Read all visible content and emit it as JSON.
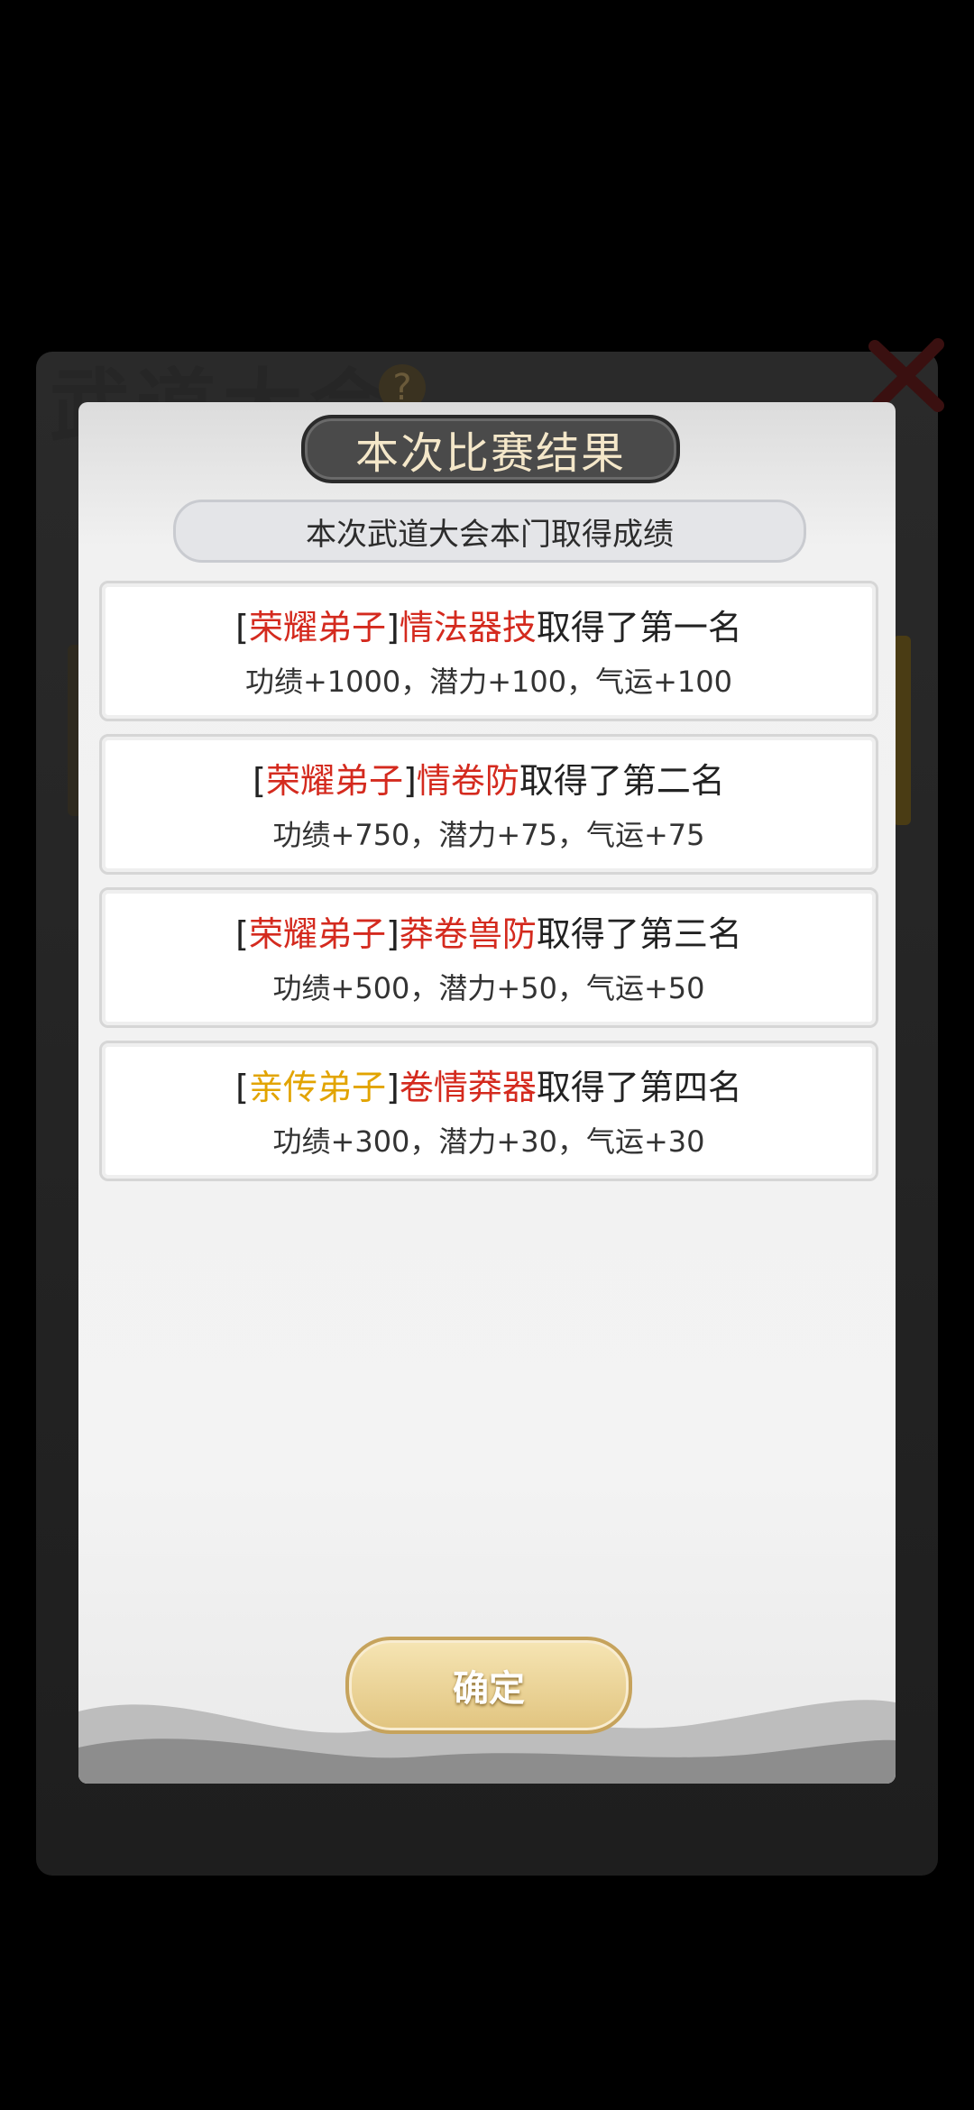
{
  "background": {
    "title": "武道大会",
    "help_glyph": "?"
  },
  "modal": {
    "header": "本次比赛结果",
    "subheader": "本次武道大会本门取得成绩",
    "results": [
      {
        "rank_tag": "荣耀弟子",
        "rank_color": "#d42a1e",
        "name": "情法器技",
        "place_text": "取得了第一名",
        "rewards": "功绩+1000，潜力+100，气运+100"
      },
      {
        "rank_tag": "荣耀弟子",
        "rank_color": "#d42a1e",
        "name": "情卷防",
        "place_text": "取得了第二名",
        "rewards": "功绩+750，潜力+75，气运+75"
      },
      {
        "rank_tag": "荣耀弟子",
        "rank_color": "#d42a1e",
        "name": "莽卷兽防",
        "place_text": "取得了第三名",
        "rewards": "功绩+500，潜力+50，气运+50"
      },
      {
        "rank_tag": "亲传弟子",
        "rank_color": "#e2a400",
        "name": "卷情莽器",
        "place_text": "取得了第四名",
        "rewards": "功绩+300，潜力+30，气运+30"
      }
    ],
    "bracket_open": "[",
    "bracket_close": "]",
    "confirm_label": "确定"
  }
}
